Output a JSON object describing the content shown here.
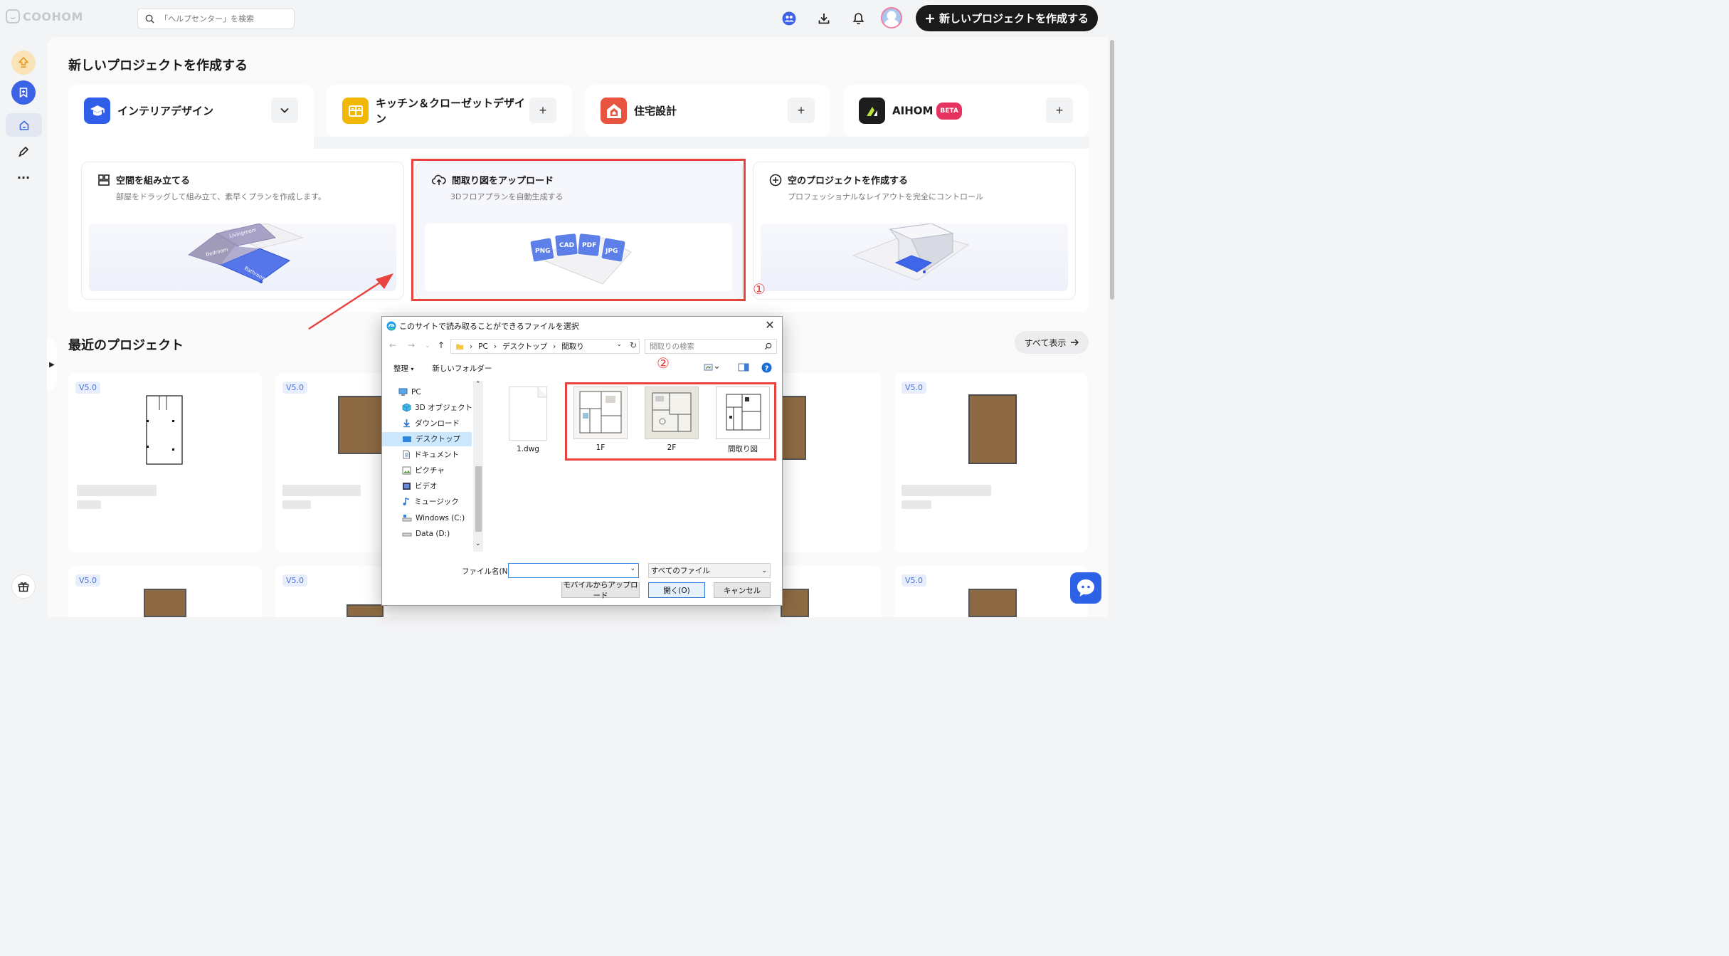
{
  "app": {
    "logo_text": "COOHOM",
    "search_placeholder": "「ヘルプセンター」を検索",
    "new_project_button": "新しいプロジェクトを作成する",
    "accent_color": "#2d61e6",
    "annotation_color": "#e8433e"
  },
  "create": {
    "heading": "新しいプロジェクトを作成する",
    "categories": [
      {
        "label": "インテリアデザイン",
        "icon": "cube-hat-icon",
        "control": "chevron-down"
      },
      {
        "label": "キッチン＆クローゼットデザイン",
        "icon": "cabinet-icon",
        "control": "+"
      },
      {
        "label": "住宅設計",
        "icon": "house-icon",
        "control": "+"
      },
      {
        "label": "AIHOM",
        "badge": "BETA",
        "icon": "aihom-icon",
        "control": "+"
      }
    ],
    "options": [
      {
        "title": "空間を組み立てる",
        "subtitle": "部屋をドラッグして組み立て、素早くプランを作成します。",
        "icon": "layout-blocks-icon",
        "rooms": [
          "Livingroom",
          "Bedroom",
          "Bathroom"
        ]
      },
      {
        "title": "間取り図をアップロード",
        "subtitle": "3Dフロアプランを自動生成する",
        "icon": "cloud-upload-icon",
        "file_types": [
          "PNG",
          "CAD",
          "PDF",
          "JPG"
        ]
      },
      {
        "title": "空のプロジェクトを作成する",
        "subtitle": "プロフェッショナルなレイアウトを完全にコントロール",
        "icon": "plus-circle-icon"
      }
    ],
    "marker_1": "①"
  },
  "recent": {
    "heading": "最近のプロジェクト",
    "view_all": "すべて表示",
    "version_badge": "V5.0"
  },
  "dialog": {
    "title": "このサイトで読み取ることができるファイルを選択",
    "breadcrumb": [
      "PC",
      "デスクトップ",
      "間取り"
    ],
    "search_placeholder": "間取りの検索",
    "organize": "整理",
    "new_folder": "新しいフォルダー",
    "tree": [
      "PC",
      "3D オブジェクト",
      "ダウンロード",
      "デスクトップ",
      "ドキュメント",
      "ピクチャ",
      "ビデオ",
      "ミュージック",
      "Windows (C:)",
      "Data (D:)"
    ],
    "selected_tree": "デスクトップ",
    "files": [
      {
        "name": "1.dwg",
        "type": "dwg"
      },
      {
        "name": "1F",
        "type": "image"
      },
      {
        "name": "2F",
        "type": "image"
      },
      {
        "name": "間取り図",
        "type": "image"
      }
    ],
    "filename_label": "ファイル名(N):",
    "filename_value": "",
    "filetype": "すべてのファイル",
    "btn_mobile": "モバイルからアップロード",
    "btn_open": "開く(O)",
    "btn_cancel": "キャンセル",
    "marker_2": "②"
  }
}
